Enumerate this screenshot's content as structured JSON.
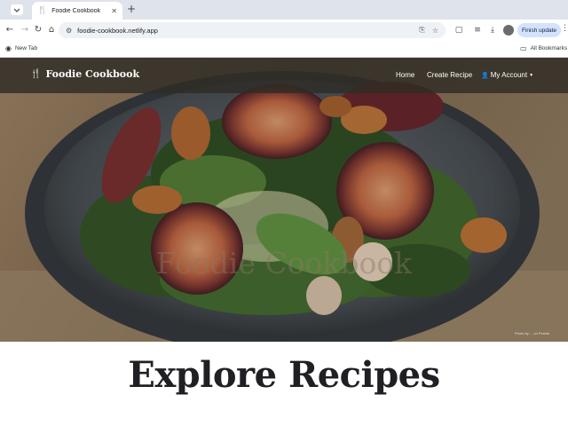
{
  "browser": {
    "tab": {
      "title": "Foodie Cookbook",
      "favicon": "fork-knife-icon"
    },
    "address_bar": {
      "url": "foodie-cookbook.netlify.app"
    },
    "finish_update_label": "Finish update",
    "bookmarks": {
      "new_tab_label": "New Tab",
      "all_bookmarks_label": "All Bookmarks"
    }
  },
  "site": {
    "brand": {
      "name": "Foodie Cookbook",
      "icon": "fork-knife-icon"
    },
    "nav": {
      "home": "Home",
      "create_recipe": "Create Recipe",
      "my_account": "My Account"
    },
    "hero": {
      "heading": "Foodie Cookbook",
      "photo_credit": "Photo by ... on Pexels"
    },
    "section_title": "Explore Recipes"
  },
  "colors": {
    "navbar_bg": "#302c26",
    "finish_update_bg": "#d3e3fd",
    "title_text": "#1f1f24"
  }
}
